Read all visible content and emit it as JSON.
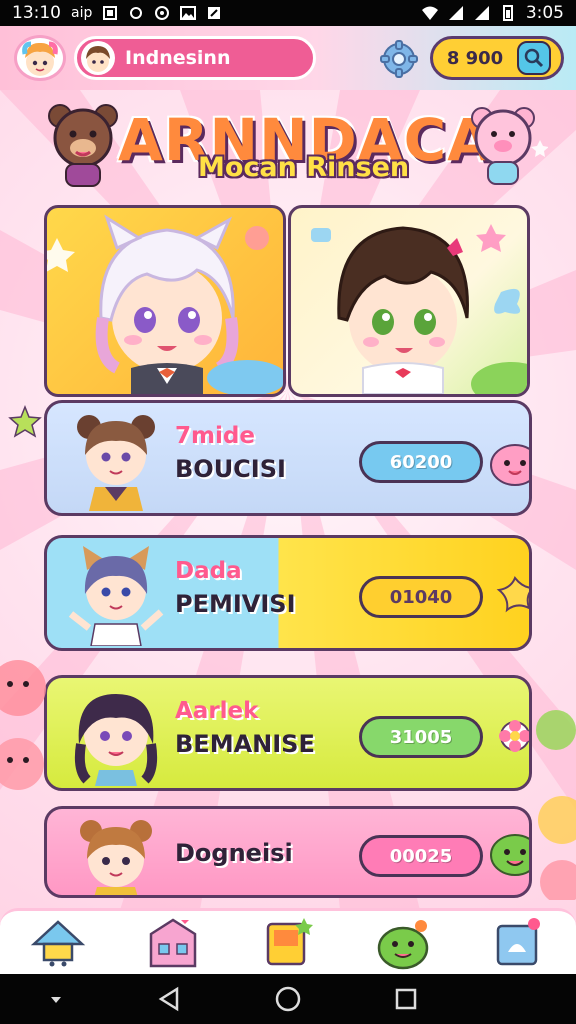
{
  "status_bar": {
    "time": "13:10",
    "carrier": "aip",
    "clock_right": "3:05"
  },
  "header": {
    "player_name": "Indnesinn",
    "currency": "8 900"
  },
  "logo": {
    "title": "ARNNDACA",
    "subtitle": "Mocan Rinsen"
  },
  "cards": [
    {
      "name": "7mide",
      "label": "BOUCISI",
      "value": "60200"
    },
    {
      "name": "Dada",
      "label": "PEMIVISI",
      "value": "01040"
    },
    {
      "name": "Aarlek",
      "label": "BEMANISE",
      "value": "31005"
    },
    {
      "name": "",
      "label": "Dogneisi",
      "value": "00025"
    }
  ],
  "colors": {
    "topbar_pink": "#ffc0d8",
    "name_pill": "#ef5d95",
    "coin_pill": "#ffcf34",
    "card1": "#c4d8f6",
    "card2_left": "#9ee0f6",
    "card2_right": "#ffd21f",
    "card3": "#d6ea3e",
    "card4": "#ff98c4",
    "outline": "#5b3a63"
  },
  "icons": {
    "bottom_nav": [
      "home-icon",
      "shop-house-icon",
      "cards-icon",
      "friends-monster-icon",
      "photo-frame-icon"
    ],
    "header": [
      "gear-icon",
      "search-icon"
    ]
  }
}
